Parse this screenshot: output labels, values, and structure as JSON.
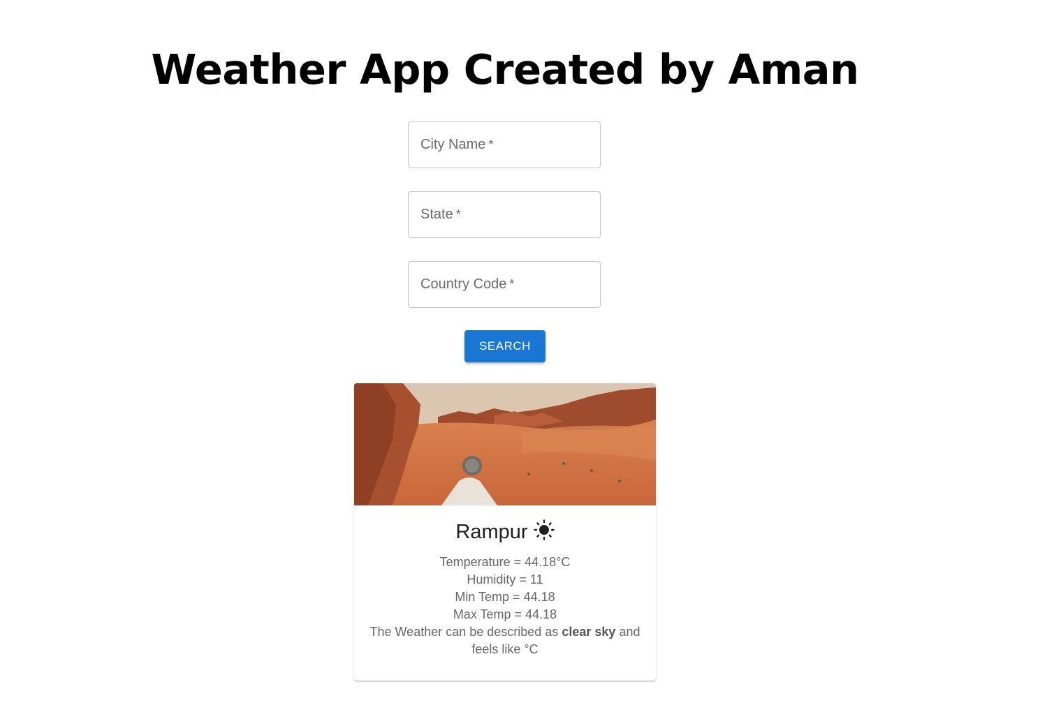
{
  "header": {
    "title": "Weather App Created by Aman"
  },
  "form": {
    "city_label": "City Name",
    "state_label": "State",
    "country_label": "Country Code",
    "required_mark": "*",
    "city_value": "",
    "state_value": "",
    "country_value": "",
    "search_label": "SEARCH"
  },
  "card": {
    "image_icon": "desert-landscape-image",
    "weather_icon": "sun-icon",
    "city": "Rampur",
    "temperature_text": "Temperature = 44.18°C",
    "humidity_text": "Humidity = 11",
    "min_temp_text": "Min Temp = 44.18",
    "max_temp_text": "Max Temp = 44.18",
    "description_prefix": "The Weather can be described as",
    "description_value": "clear sky",
    "description_suffix": "and feels like °C"
  },
  "colors": {
    "primary": "#1976d2",
    "field_border": "#c4c4c4",
    "label_text": "#6b6b6b"
  }
}
